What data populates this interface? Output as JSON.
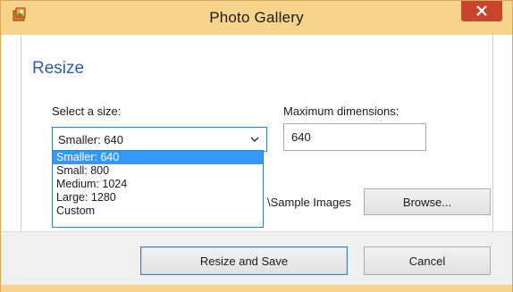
{
  "window": {
    "title": "Photo Gallery",
    "accent_color": "#f6d48c",
    "close_color": "#c7452f"
  },
  "page": {
    "heading": "Resize",
    "size_label": "Select a size:",
    "dimensions_label": "Maximum dimensions:"
  },
  "size_select": {
    "selected": "Smaller: 640",
    "options": [
      "Smaller: 640",
      "Small: 800",
      "Medium: 1024",
      "Large: 1280",
      "Custom"
    ],
    "highlighted_index": 0
  },
  "dimensions_input": {
    "value": "640"
  },
  "folder": {
    "path_fragment": "\\Sample Images",
    "browse_label": "Browse..."
  },
  "buttons": {
    "resize_save": "Resize and Save",
    "cancel": "Cancel"
  }
}
